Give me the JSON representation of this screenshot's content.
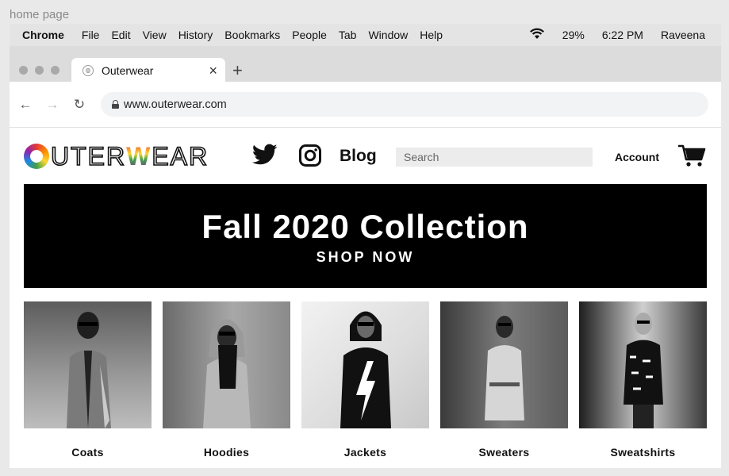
{
  "page_label": "home page",
  "menubar": {
    "app": "Chrome",
    "items": [
      "File",
      "Edit",
      "View",
      "History",
      "Bookmarks",
      "People",
      "Tab",
      "Window",
      "Help"
    ],
    "battery": "29%",
    "time": "6:22 PM",
    "user": "Raveena"
  },
  "browser": {
    "tab_title": "Outerwear",
    "url": "www.outerwear.com"
  },
  "site": {
    "logo": {
      "letters": [
        "U",
        "T",
        "E",
        "R",
        "W",
        "E",
        "A",
        "R"
      ]
    },
    "blog_label": "Blog",
    "search_placeholder": "Search",
    "account_label": "Account",
    "hero": {
      "title": "Fall 2020 Collection",
      "cta": "SHOP NOW"
    },
    "categories": [
      {
        "label": "Coats"
      },
      {
        "label": "Hoodies"
      },
      {
        "label": "Jackets"
      },
      {
        "label": "Sweaters"
      },
      {
        "label": "Sweatshirts"
      }
    ]
  }
}
